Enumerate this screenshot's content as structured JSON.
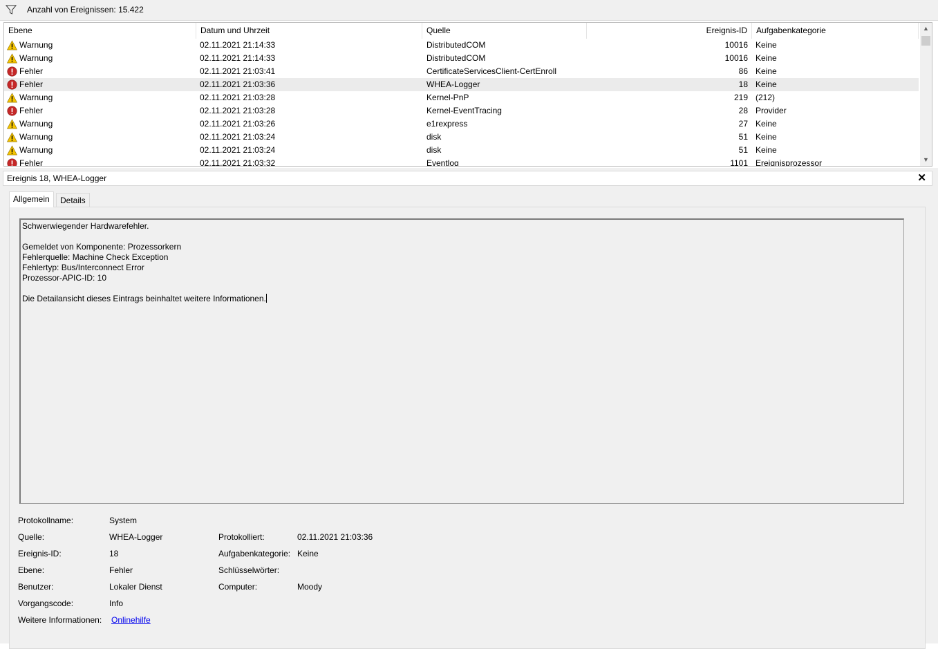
{
  "toolbar": {
    "filter_icon": "filter-funnel-icon",
    "count_label": "Anzahl von Ereignissen: 15.422"
  },
  "list": {
    "columns": [
      "Ebene",
      "Datum und Uhrzeit",
      "Quelle",
      "Ereignis-ID",
      "Aufgabenkategorie"
    ],
    "rows": [
      {
        "level": "Warnung",
        "icon": "warning-icon",
        "date": "02.11.2021 21:14:33",
        "source": "DistributedCOM",
        "id": "10016",
        "category": "Keine"
      },
      {
        "level": "Warnung",
        "icon": "warning-icon",
        "date": "02.11.2021 21:14:33",
        "source": "DistributedCOM",
        "id": "10016",
        "category": "Keine"
      },
      {
        "level": "Fehler",
        "icon": "error-icon",
        "date": "02.11.2021 21:03:41",
        "source": "CertificateServicesClient-CertEnroll",
        "id": "86",
        "category": "Keine"
      },
      {
        "level": "Fehler",
        "icon": "error-icon",
        "date": "02.11.2021 21:03:36",
        "source": "WHEA-Logger",
        "id": "18",
        "category": "Keine",
        "selected": true
      },
      {
        "level": "Warnung",
        "icon": "warning-icon",
        "date": "02.11.2021 21:03:28",
        "source": "Kernel-PnP",
        "id": "219",
        "category": "(212)"
      },
      {
        "level": "Fehler",
        "icon": "error-icon",
        "date": "02.11.2021 21:03:28",
        "source": "Kernel-EventTracing",
        "id": "28",
        "category": "Provider"
      },
      {
        "level": "Warnung",
        "icon": "warning-icon",
        "date": "02.11.2021 21:03:26",
        "source": "e1rexpress",
        "id": "27",
        "category": "Keine"
      },
      {
        "level": "Warnung",
        "icon": "warning-icon",
        "date": "02.11.2021 21:03:24",
        "source": "disk",
        "id": "51",
        "category": "Keine"
      },
      {
        "level": "Warnung",
        "icon": "warning-icon",
        "date": "02.11.2021 21:03:24",
        "source": "disk",
        "id": "51",
        "category": "Keine"
      },
      {
        "level": "Fehler",
        "icon": "error-icon",
        "date": "02.11.2021 21:03:32",
        "source": "Eventlog",
        "id": "1101",
        "category": "Ereignisprozessor"
      }
    ]
  },
  "detail": {
    "title": "Ereignis 18, WHEA-Logger",
    "close_icon": "close-icon",
    "tabs": [
      "Allgemein",
      "Details"
    ],
    "message": [
      "Schwerwiegender Hardwarefehler.",
      "",
      "Gemeldet von Komponente: Prozessorkern",
      "Fehlerquelle: Machine Check Exception",
      "Fehlertyp: Bus/Interconnect Error",
      "Prozessor-APIC-ID: 10",
      "",
      "Die Detailansicht dieses Eintrags beinhaltet weitere Informationen."
    ],
    "props": {
      "log_name_label": "Protokollname:",
      "log_name": "System",
      "source_label": "Quelle:",
      "source": "WHEA-Logger",
      "logged_label": "Protokolliert:",
      "logged": "02.11.2021 21:03:36",
      "event_id_label": "Ereignis-ID:",
      "event_id": "18",
      "task_category_label": "Aufgabenkategorie:",
      "task_category": "Keine",
      "level_label": "Ebene:",
      "level": "Fehler",
      "keywords_label": "Schlüsselwörter:",
      "keywords": "",
      "user_label": "Benutzer:",
      "user": "Lokaler Dienst",
      "computer_label": "Computer:",
      "computer": "Moody",
      "opcode_label": "Vorgangscode:",
      "opcode": "Info",
      "more_info_label": "Weitere Informationen:",
      "more_info_link": "Onlinehilfe"
    }
  },
  "colors": {
    "warning": "#f5c400",
    "error": "#c62828",
    "selected_row": "#ebebeb",
    "link": "#0000ee"
  }
}
